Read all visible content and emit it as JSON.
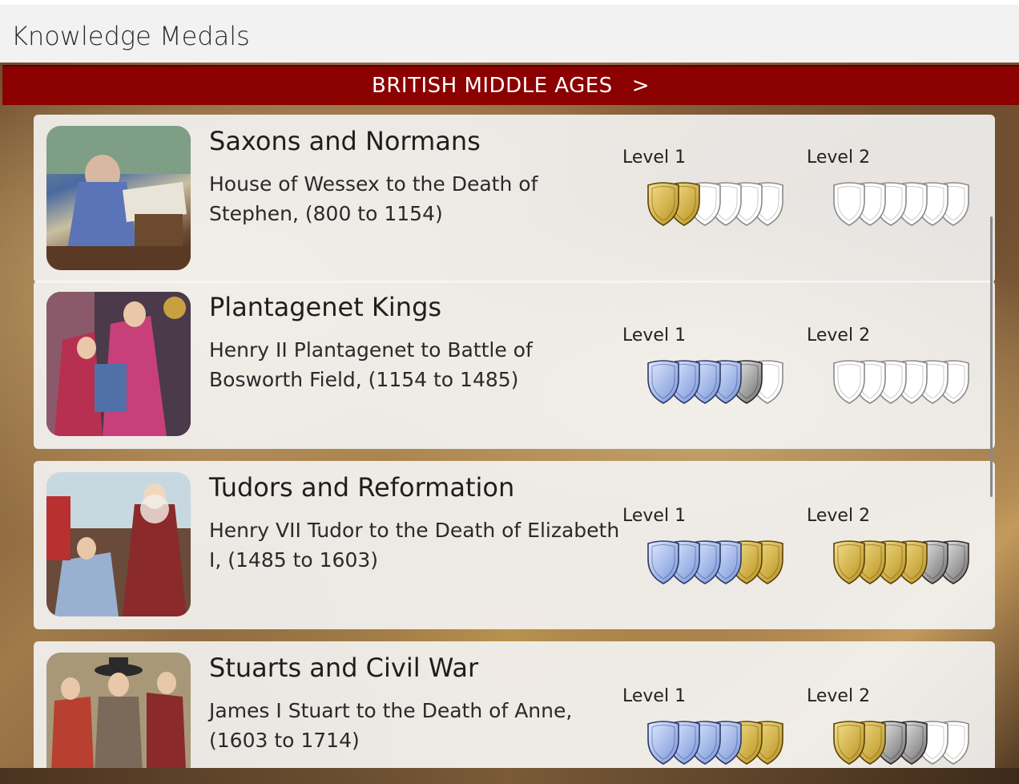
{
  "app": {
    "title": "Knowledge Medals"
  },
  "banner": {
    "label": "BRITISH MIDDLE AGES",
    "chevron": ">"
  },
  "colors": {
    "banner": "#8b0000",
    "gold": "#d4af37",
    "silver": "#a8a8a8",
    "blue": "#9bb4e8",
    "empty": "#ffffff"
  },
  "courses": [
    {
      "title": "Saxons and Normans",
      "desc": "House of Wessex to the Death of Stephen, (800 to 1154)",
      "image_icon": "saxon-king-illustration",
      "level1_label": "Level 1",
      "level2_label": "Level 2",
      "level1": [
        "gold",
        "gold",
        "empty",
        "empty",
        "empty",
        "empty"
      ],
      "level2": [
        "empty",
        "empty",
        "empty",
        "empty",
        "empty",
        "empty"
      ]
    },
    {
      "title": "Plantagenet Kings",
      "desc": "Henry II Plantagenet to Battle of Bosworth Field, (1154 to 1485)",
      "image_icon": "plantagenet-court-illustration",
      "level1_label": "Level 1",
      "level2_label": "Level 2",
      "level1": [
        "blue",
        "blue",
        "blue",
        "blue",
        "silver",
        "empty"
      ],
      "level2": [
        "empty",
        "empty",
        "empty",
        "empty",
        "empty",
        "empty"
      ]
    },
    {
      "title": "Tudors and Reformation",
      "desc": "Henry VII Tudor to the Death of Elizabeth I, (1485 to 1603)",
      "image_icon": "tudor-queen-illustration",
      "level1_label": "Level 1",
      "level2_label": "Level 2",
      "level1": [
        "blue",
        "blue",
        "blue",
        "blue",
        "gold",
        "gold"
      ],
      "level2": [
        "gold",
        "gold",
        "gold",
        "gold",
        "silver",
        "silver"
      ]
    },
    {
      "title": "Stuarts and Civil War",
      "desc": "James I Stuart to the Death of Anne, (1603 to 1714)",
      "image_icon": "stuart-cavaliers-illustration",
      "level1_label": "Level 1",
      "level2_label": "Level 2",
      "level1": [
        "blue",
        "blue",
        "blue",
        "blue",
        "gold",
        "gold"
      ],
      "level2": [
        "gold",
        "gold",
        "silver",
        "silver",
        "empty",
        "empty"
      ]
    }
  ]
}
